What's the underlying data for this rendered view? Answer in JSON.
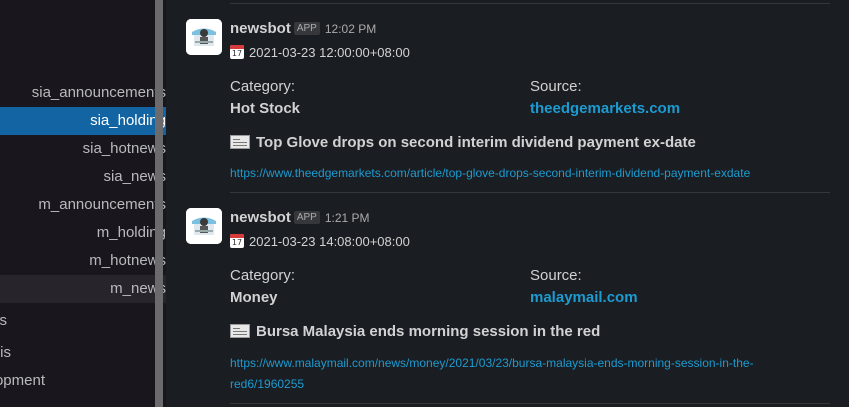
{
  "sidebar": {
    "channels": [
      {
        "label": "sia_announcements",
        "state": "normal"
      },
      {
        "label": "sia_holding",
        "state": "active"
      },
      {
        "label": "sia_hotnews",
        "state": "normal"
      },
      {
        "label": "sia_news",
        "state": "normal"
      },
      {
        "label": "m_announcements",
        "state": "normal"
      },
      {
        "label": "m_holding",
        "state": "normal"
      },
      {
        "label": "m_hotnews",
        "state": "normal"
      },
      {
        "label": "m_news",
        "state": "hover"
      },
      {
        "label": "s",
        "state": "normal"
      },
      {
        "label": "is",
        "state": "normal"
      },
      {
        "label": "opment",
        "state": "normal"
      }
    ]
  },
  "messages": [
    {
      "sender": "newsbot",
      "badge": "APP",
      "time": "12:02 PM",
      "calendar_icon_number": "17",
      "date": "2021-03-23 12:00:00+08:00",
      "category_label": "Category:",
      "category_value": "Hot Stock",
      "source_label": "Source:",
      "source_value": "theedgemarkets.com",
      "title": "Top Glove drops on second interim dividend payment ex-date",
      "url": "https://www.theedgemarkets.com/article/top-glove-drops-second-interim-dividend-payment-exdate"
    },
    {
      "sender": "newsbot",
      "badge": "APP",
      "time": "1:21 PM",
      "calendar_icon_number": "17",
      "date": "2021-03-23 14:08:00+08:00",
      "category_label": "Category:",
      "category_value": "Money",
      "source_label": "Source:",
      "source_value": "malaymail.com",
      "title": "Bursa Malaysia ends morning session in the red",
      "url": "https://www.malaymail.com/news/money/2021/03/23/bursa-malaysia-ends-morning-session-in-the-red6/1960255"
    }
  ],
  "colors": {
    "background": "#1a1d21",
    "sidebar": "#19171d",
    "active_channel": "#1264a3",
    "link": "#1d9bd1"
  }
}
